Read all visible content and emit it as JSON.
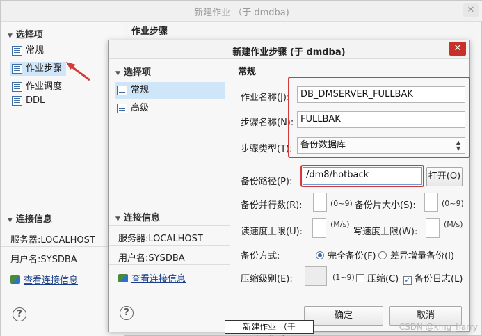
{
  "bg_window": {
    "title": "新建作业 （于 dmdba)",
    "close_glyph": "✕",
    "sidebar_title": "选择项",
    "nav": [
      "常规",
      "作业步骤",
      "作业调度",
      "DDL"
    ],
    "right_header": "作业步骤",
    "conn_title": "连接信息",
    "server": "服务器:LOCALHOST",
    "user": "用户名:SYSDBA",
    "view_conn": "查看连接信息",
    "help": "?"
  },
  "dialog": {
    "title": "新建作业步骤 (于 dmdba)",
    "close_glyph": "✕",
    "sidebar_title": "选择项",
    "nav": [
      "常规",
      "高级"
    ],
    "conn_title": "连接信息",
    "server": "服务器:LOCALHOST",
    "user": "用户名:SYSDBA",
    "view_conn": "查看连接信息",
    "help": "?",
    "section": "常规",
    "job_name_label": "作业名称(J):",
    "job_name_value": "DB_DMSERVER_FULLBAK",
    "step_name_label": "步骤名称(N):",
    "step_name_value": "FULLBAK",
    "step_type_label": "步骤类型(T):",
    "step_type_value": "备份数据库",
    "backup_path_label": "备份路径(P):",
    "backup_path_value": "/dm8/hotback",
    "open_button": "打开(O)",
    "parallel_label": "备份并行数(R):",
    "parallel_unit": "(0~9)",
    "piece_label": "备份片大小(S):",
    "piece_unit": "(0~9)",
    "read_limit_label": "读速度上限(U):",
    "read_unit": "(M/s)",
    "write_limit_label": "写速度上限(W):",
    "write_unit": "(M/s)",
    "mode_label": "备份方式:",
    "mode_full": "完全备份(F)",
    "mode_incr": "差异增量备份(I)",
    "compress_label": "压缩级别(E):",
    "compress_unit": "(1~9)",
    "compress_check": "压缩(C)",
    "log_check": "备份日志(L)",
    "ok": "确定",
    "cancel": "取消"
  },
  "tooltip": "新建作业 （于 dmdba)",
  "watermark": "CSDN @king_harry",
  "colors": {
    "highlight_red": "#d23b3b",
    "selection_blue": "#cfe5f8",
    "close_red": "#c8312a"
  }
}
